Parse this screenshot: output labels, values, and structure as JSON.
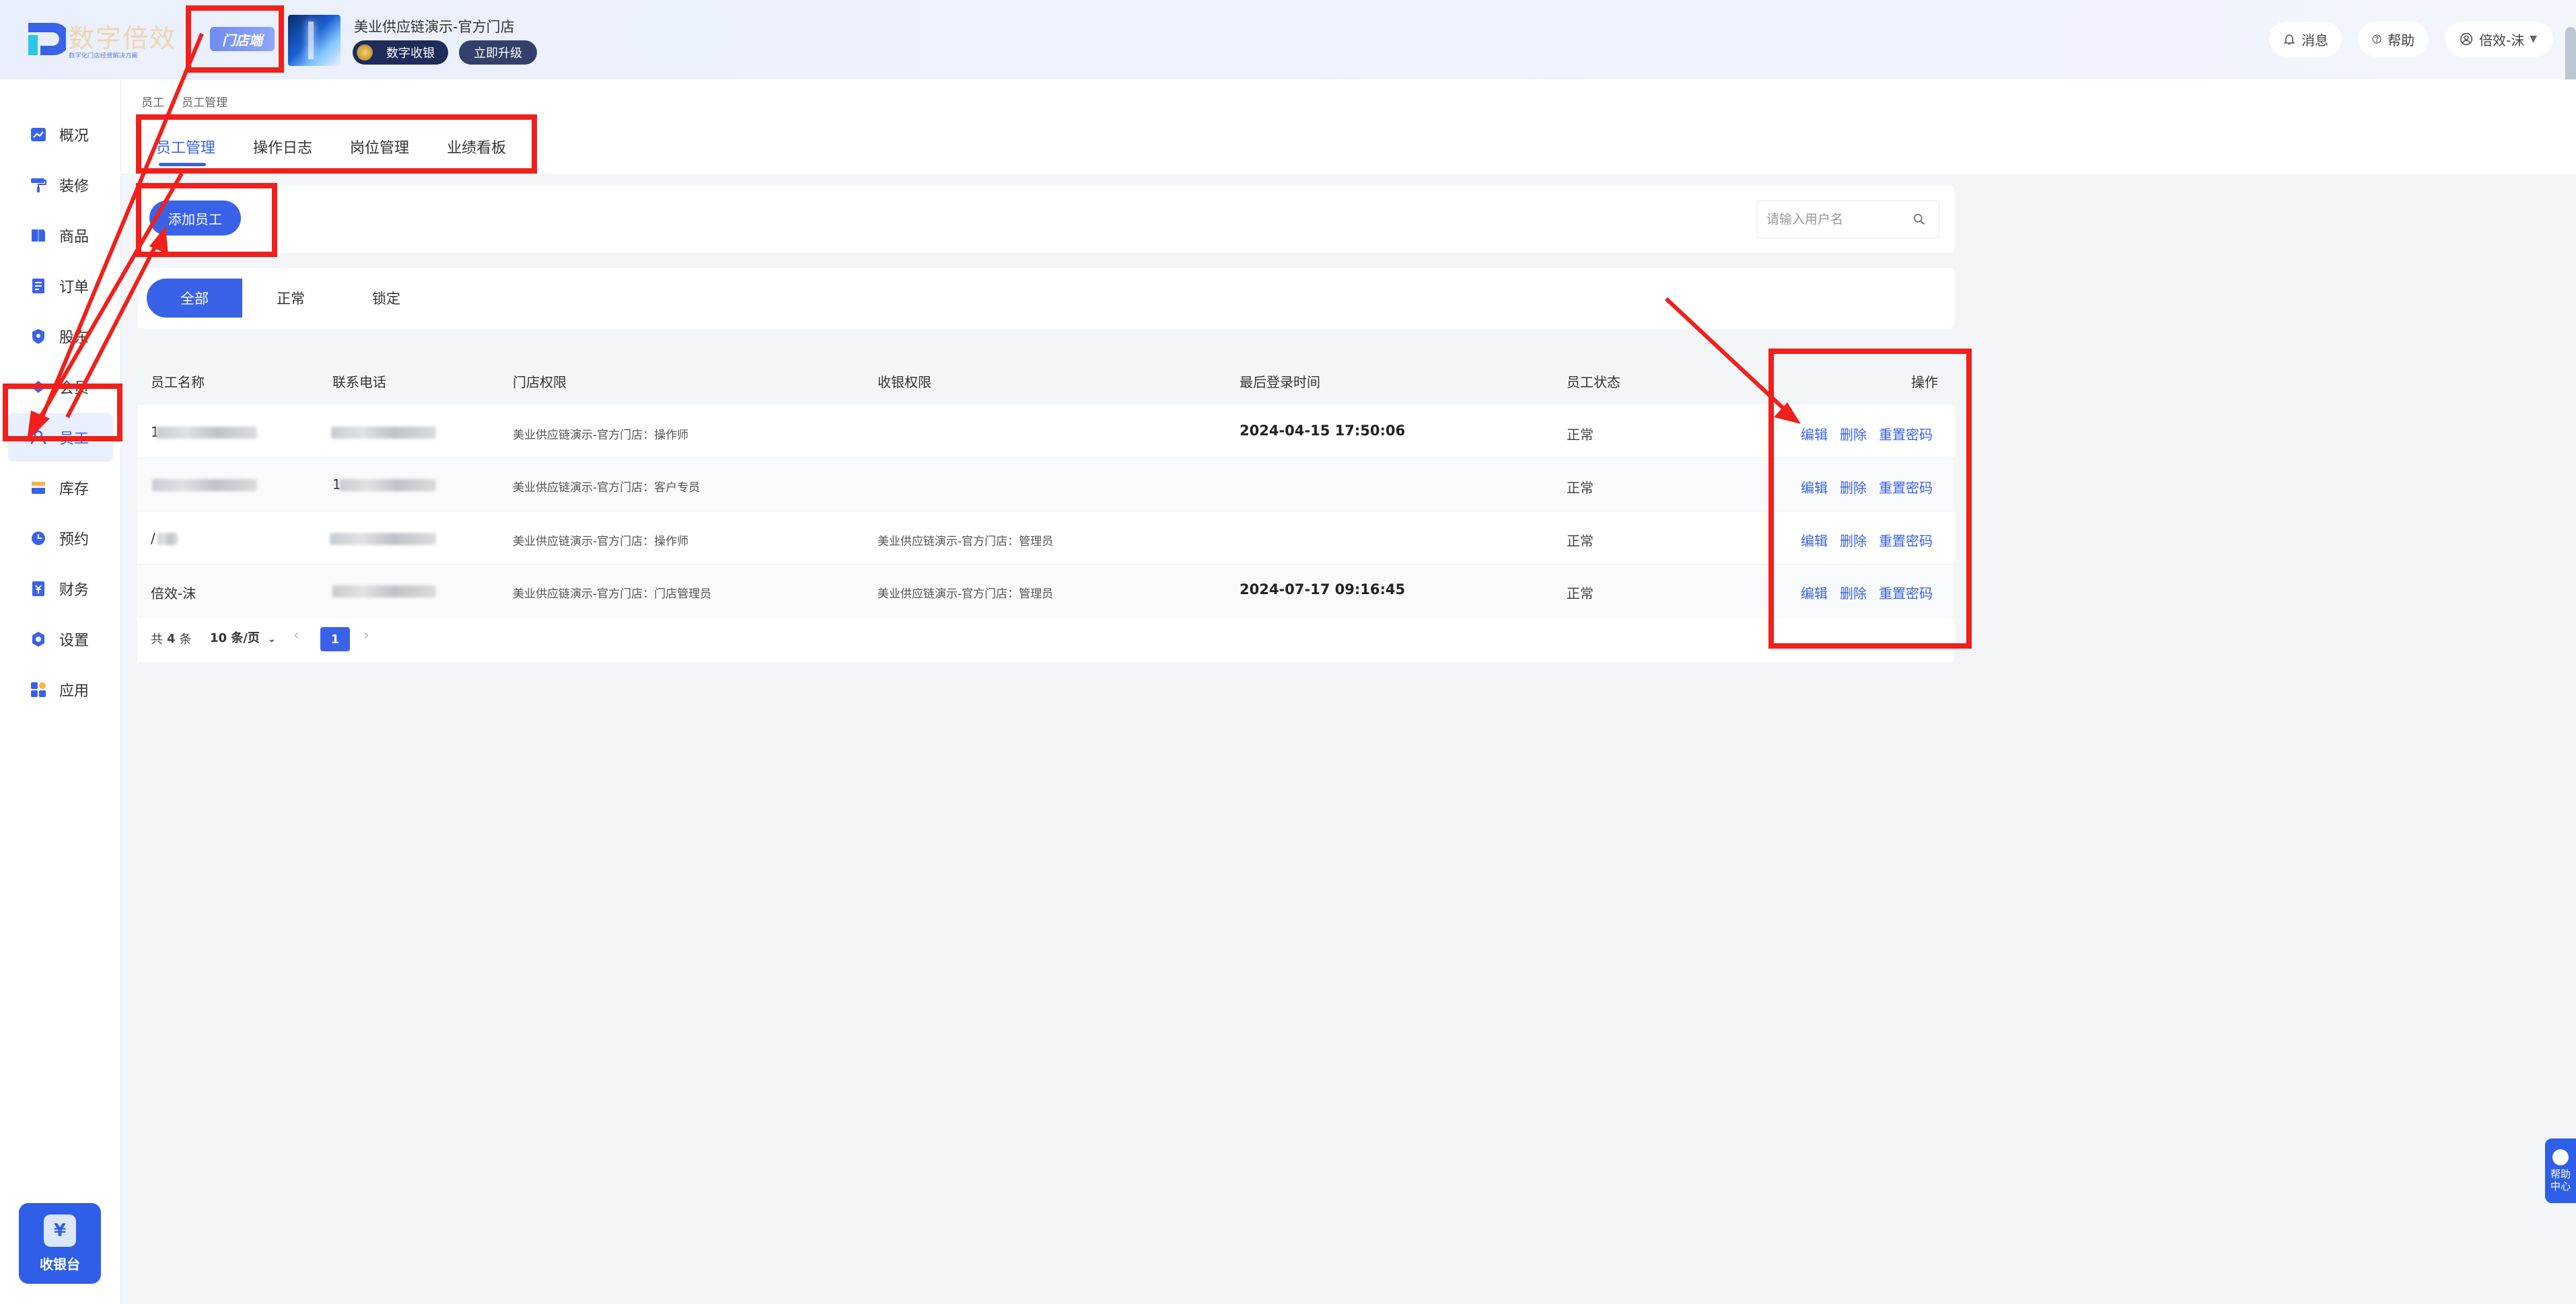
{
  "header": {
    "logo_text": "数字倍效",
    "logo_sub": "数字化门店经营解决方案",
    "store_badge": "门店端",
    "store_name": "美业供应链演示-官方门店",
    "pay_label": "数字收银",
    "upgrade_label": "立即升级",
    "messages": "消息",
    "help": "帮助",
    "user": "倍效-沫"
  },
  "sidebar": {
    "items": [
      {
        "label": "概况",
        "icon": "chart-line-icon"
      },
      {
        "label": "装修",
        "icon": "paint-roller-icon"
      },
      {
        "label": "商品",
        "icon": "product-icon"
      },
      {
        "label": "订单",
        "icon": "order-icon"
      },
      {
        "label": "股东",
        "icon": "shield-icon"
      },
      {
        "label": "会员",
        "icon": "member-icon"
      },
      {
        "label": "员工",
        "icon": "staff-icon",
        "active": true
      },
      {
        "label": "库存",
        "icon": "inventory-icon"
      },
      {
        "label": "预约",
        "icon": "clock-icon"
      },
      {
        "label": "财务",
        "icon": "finance-icon"
      },
      {
        "label": "设置",
        "icon": "gear-icon"
      },
      {
        "label": "应用",
        "icon": "apps-grid-icon"
      }
    ],
    "cashier": "收银台"
  },
  "breadcrumb": {
    "parent": "员工",
    "current": "员工管理"
  },
  "tabs": [
    "员工管理",
    "操作日志",
    "岗位管理",
    "业绩看板"
  ],
  "toolbar": {
    "add_label": "添加员工",
    "search_placeholder": "请输入用户名"
  },
  "filters": [
    "全部",
    "正常",
    "锁定"
  ],
  "table": {
    "columns": [
      "员工名称",
      "联系电话",
      "门店权限",
      "收银权限",
      "最后登录时间",
      "员工状态",
      "操作"
    ],
    "rows": [
      {
        "name": "1",
        "phone": "",
        "store_perm": "美业供应链演示-官方门店：操作师",
        "cash_perm": "",
        "last_login": "2024-04-15 17:50:06",
        "status": "正常"
      },
      {
        "name": "",
        "phone": "1",
        "store_perm": "美业供应链演示-官方门店：客户专员",
        "cash_perm": "",
        "last_login": "",
        "status": "正常"
      },
      {
        "name": "/",
        "phone": "",
        "store_perm": "美业供应链演示-官方门店：操作师",
        "cash_perm": "美业供应链演示-官方门店：管理员",
        "last_login": "",
        "status": "正常"
      },
      {
        "name": "倍效-沫",
        "phone": "",
        "store_perm": "美业供应链演示-官方门店：门店管理员",
        "cash_perm": "美业供应链演示-官方门店：管理员",
        "last_login": "2024-07-17 09:16:45",
        "status": "正常"
      }
    ],
    "actions": [
      "编辑",
      "删除",
      "重置密码"
    ]
  },
  "pagination": {
    "total_prefix": "共",
    "total": "4",
    "total_suffix": "条",
    "page_size": "10 条/页",
    "current": "1"
  },
  "help_float": {
    "line1": "帮助",
    "line2": "中心"
  },
  "colors": {
    "accent": "#3a62e8",
    "annotation": "#f0201c"
  }
}
